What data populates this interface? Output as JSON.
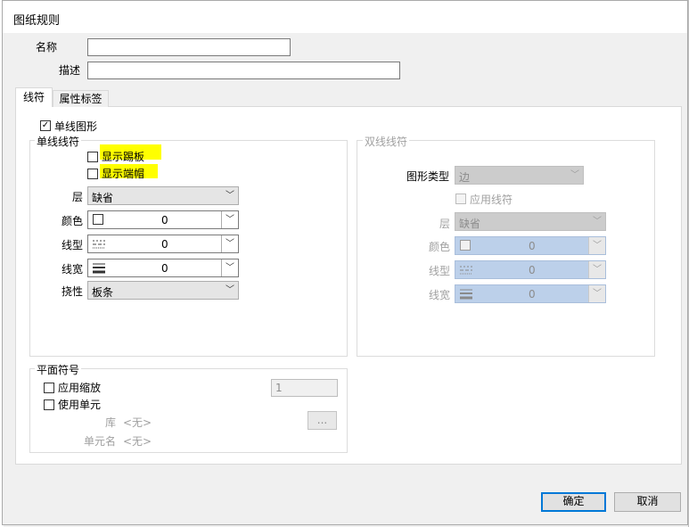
{
  "dialog": {
    "title": "图纸规则"
  },
  "fields": {
    "name_label": "名称",
    "name_value": "",
    "desc_label": "描述",
    "desc_value": ""
  },
  "tabs": [
    {
      "label": "线符",
      "active": true
    },
    {
      "label": "属性标签",
      "active": false
    }
  ],
  "line_symbol": {
    "single_graphic_label": "单线图形",
    "single_graphic_checked": true,
    "single_group": {
      "legend": "单线线符",
      "show_skirting_label": "显示踢板",
      "show_skirting_checked": false,
      "show_endcap_label": "显示端帽",
      "show_endcap_checked": false,
      "layer_label": "层",
      "layer_value": "缺省",
      "color_label": "颜色",
      "color_value": "0",
      "linetype_label": "线型",
      "linetype_value": "0",
      "lineweight_label": "线宽",
      "lineweight_value": "0",
      "flex_label": "挠性",
      "flex_value": "板条"
    },
    "double_group": {
      "legend": "双线线符",
      "shape_type_label": "图形类型",
      "shape_type_value": "边",
      "apply_linesymbol_label": "应用线符",
      "layer_label": "层",
      "layer_value": "缺省",
      "color_label": "颜色",
      "color_value": "0",
      "linetype_label": "线型",
      "linetype_value": "0",
      "lineweight_label": "线宽",
      "lineweight_value": "0"
    },
    "plan_symbol": {
      "legend": "平面符号",
      "apply_scale_label": "应用缩放",
      "apply_scale_value": "1",
      "use_block_label": "使用单元",
      "library_label": "库",
      "library_value": "<无>",
      "browse_label": "...",
      "block_name_label": "单元名",
      "block_name_value": "<无>"
    }
  },
  "buttons": {
    "ok": "确定",
    "cancel": "取消"
  },
  "colors": {
    "highlight": "#ffff00",
    "accent": "#0078d7",
    "disabled_blue": "#bcd0ea"
  }
}
